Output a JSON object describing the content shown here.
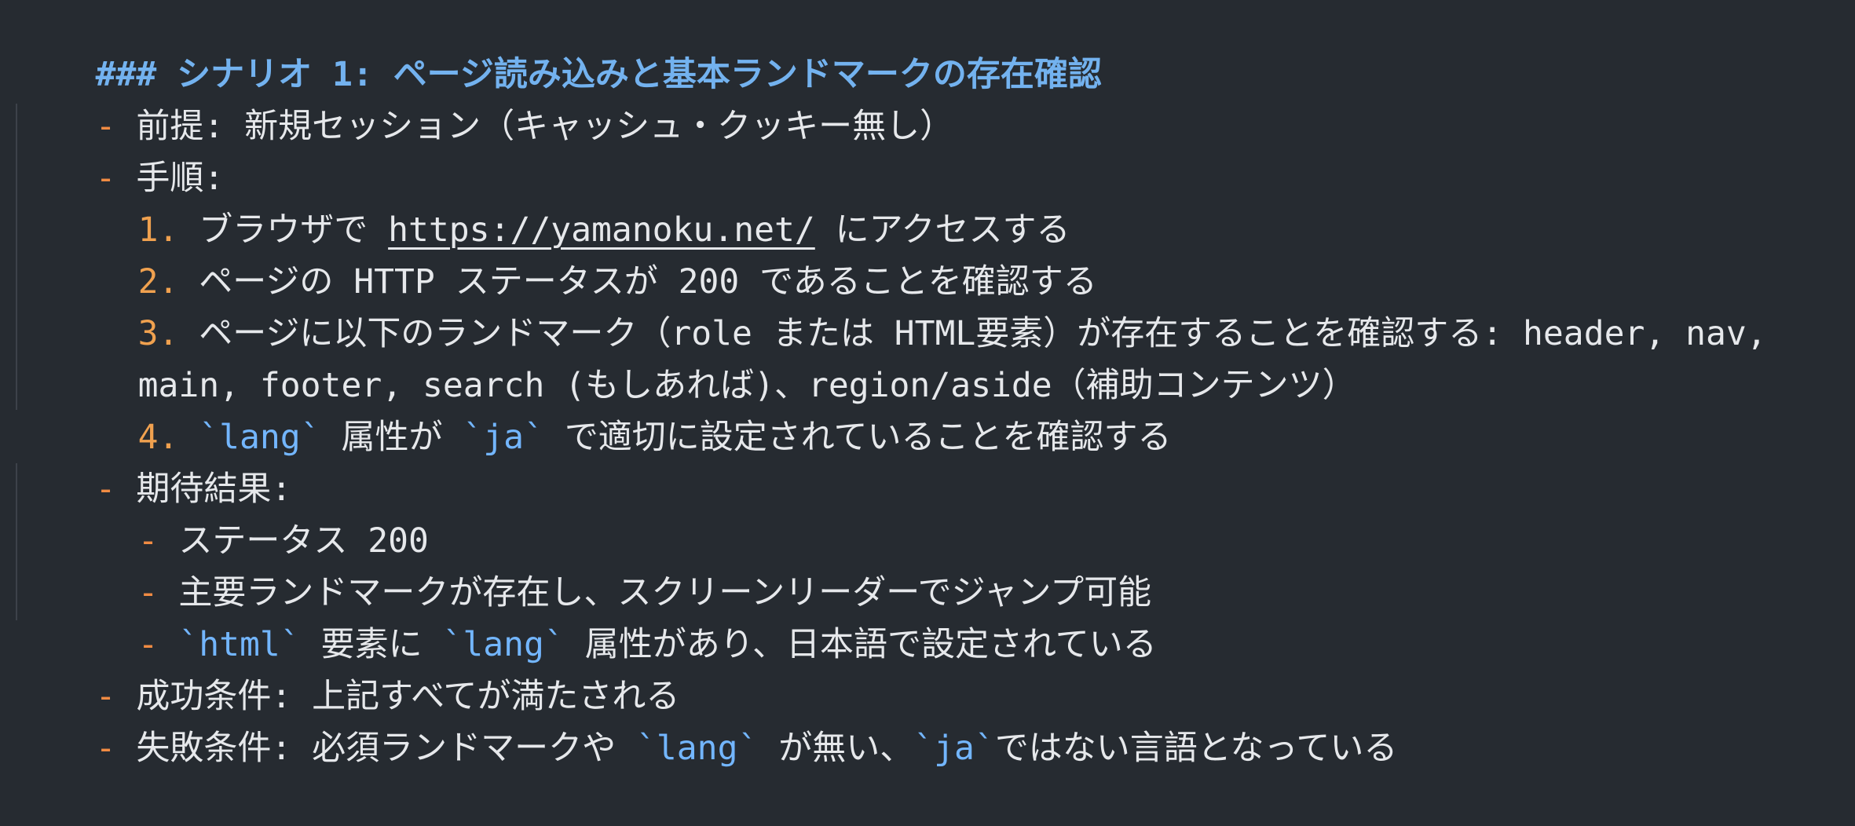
{
  "editor": {
    "heading": {
      "marker": "###",
      "title": "シナリオ 1: ページ読み込みと基本ランドマークの存在確認"
    },
    "lines": {
      "precondition": {
        "label": "前提:",
        "text": "新規セッション（キャッシュ・クッキー無し）"
      },
      "steps_label": "手順:",
      "step1": {
        "num": "1.",
        "text_before": "ブラウザで",
        "url": "https://yamanoku.net/",
        "text_after": "にアクセスする"
      },
      "step2": {
        "num": "2.",
        "text": "ページの HTTP ステータスが 200 であることを確認する"
      },
      "step3": {
        "num": "3.",
        "text_line1": "ページに以下のランドマーク（role または HTML要素）が存在することを確認する: header, nav,",
        "text_line2": "main, footer, search (もしあれば)、region/aside（補助コンテンツ）"
      },
      "step4": {
        "num": "4.",
        "code1": "`lang`",
        "text_mid": "属性が",
        "code2": "`ja`",
        "text_after": "で適切に設定されていることを確認する"
      },
      "expected_label": "期待結果:",
      "expected1": "ステータス 200",
      "expected2": "主要ランドマークが存在し、スクリーンリーダーでジャンプ可能",
      "expected3": {
        "code1": "`html`",
        "text_mid": "要素に",
        "code2": "`lang`",
        "text_after": "属性があり、日本語で設定されている"
      },
      "success": {
        "label": "成功条件:",
        "text": "上記すべてが満たされる"
      },
      "failure": {
        "label": "失敗条件:",
        "text_before": "必須ランドマークや",
        "code1": "`lang`",
        "text_mid": "が無い、",
        "code2": "`ja`",
        "text_after": "ではない言語となっている"
      }
    },
    "bullet": "-",
    "colors": {
      "background": "#262b31",
      "heading": "#73b2ef",
      "bullet": "#f08b43",
      "code": "#73b6ff",
      "text": "#e6e8eb"
    }
  }
}
